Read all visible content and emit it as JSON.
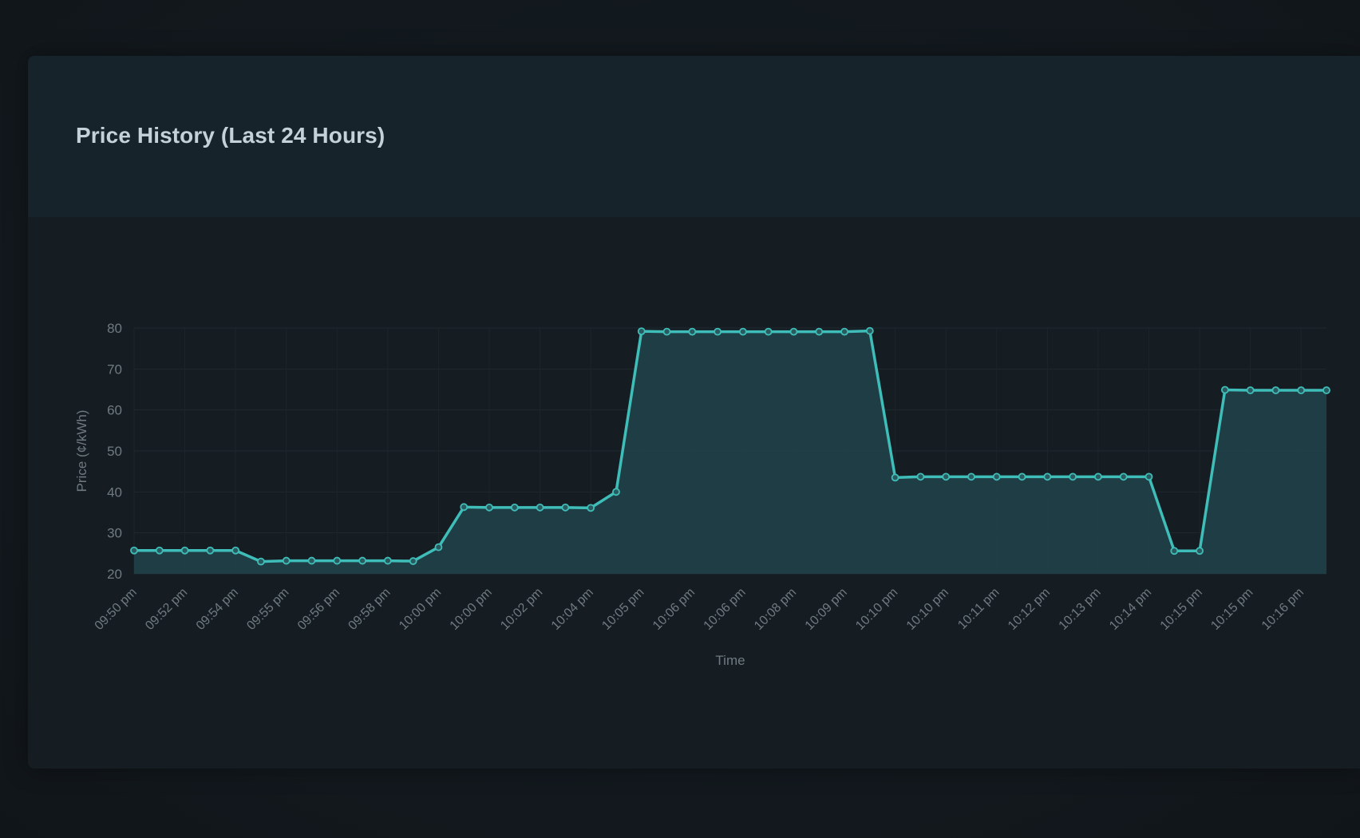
{
  "header": {
    "title": "Price History (Last 24 Hours)"
  },
  "colors": {
    "line": "#3fbdb8",
    "fill": "#21434a"
  },
  "chart_data": {
    "type": "area",
    "xlabel": "Time",
    "ylabel": "Price (¢/kWh)",
    "ylim": [
      20,
      80
    ],
    "yticks": [
      20,
      30,
      40,
      50,
      60,
      70,
      80
    ],
    "grid": true,
    "x": [
      "09:50 pm",
      "",
      "09:52 pm",
      "",
      "09:54 pm",
      "",
      "09:55 pm",
      "",
      "09:56 pm",
      "",
      "09:58 pm",
      "",
      "10:00 pm",
      "",
      "10:00 pm",
      "",
      "10:02 pm",
      "",
      "10:04 pm",
      "",
      "10:05 pm",
      "",
      "10:06 pm",
      "",
      "10:06 pm",
      "",
      "10:08 pm",
      "",
      "10:09 pm",
      "",
      "10:10 pm",
      "",
      "10:10 pm",
      "",
      "10:11 pm",
      "",
      "10:12 pm",
      "",
      "10:13 pm",
      "",
      "10:14 pm",
      "",
      "10:15 pm",
      "",
      "10:15 pm",
      "",
      "10:16 pm",
      ""
    ],
    "values": [
      25.7,
      25.7,
      25.7,
      25.7,
      25.7,
      23.0,
      23.2,
      23.2,
      23.2,
      23.2,
      23.2,
      23.1,
      26.5,
      36.3,
      36.2,
      36.2,
      36.2,
      36.2,
      36.1,
      40.0,
      79.2,
      79.1,
      79.1,
      79.1,
      79.1,
      79.1,
      79.1,
      79.1,
      79.1,
      79.3,
      43.5,
      43.7,
      43.7,
      43.7,
      43.7,
      43.7,
      43.7,
      43.7,
      43.7,
      43.7,
      43.7,
      25.6,
      25.6,
      64.9,
      64.8,
      64.8,
      64.8,
      64.8
    ]
  }
}
